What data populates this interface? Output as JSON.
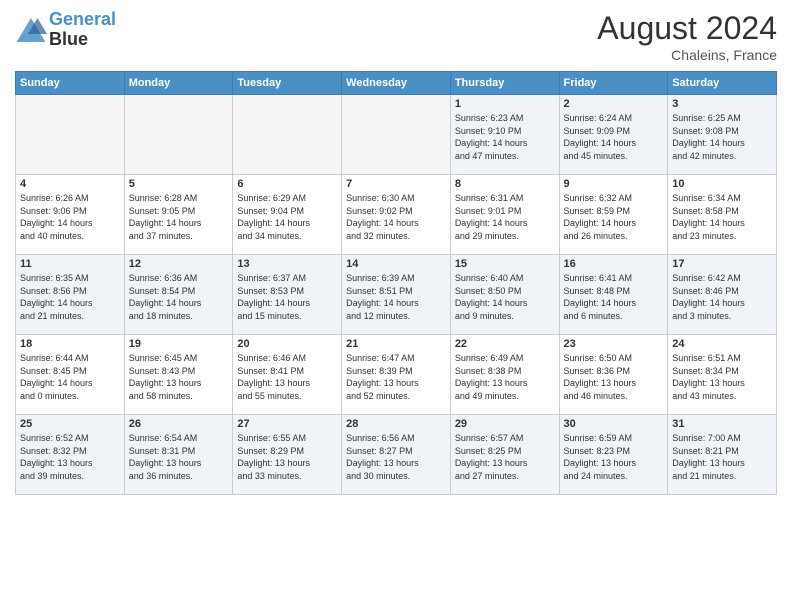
{
  "header": {
    "logo_line1": "General",
    "logo_line2": "Blue",
    "month_year": "August 2024",
    "location": "Chaleins, France"
  },
  "weekdays": [
    "Sunday",
    "Monday",
    "Tuesday",
    "Wednesday",
    "Thursday",
    "Friday",
    "Saturday"
  ],
  "weeks": [
    [
      {
        "day": "",
        "info": ""
      },
      {
        "day": "",
        "info": ""
      },
      {
        "day": "",
        "info": ""
      },
      {
        "day": "",
        "info": ""
      },
      {
        "day": "1",
        "info": "Sunrise: 6:23 AM\nSunset: 9:10 PM\nDaylight: 14 hours\nand 47 minutes."
      },
      {
        "day": "2",
        "info": "Sunrise: 6:24 AM\nSunset: 9:09 PM\nDaylight: 14 hours\nand 45 minutes."
      },
      {
        "day": "3",
        "info": "Sunrise: 6:25 AM\nSunset: 9:08 PM\nDaylight: 14 hours\nand 42 minutes."
      }
    ],
    [
      {
        "day": "4",
        "info": "Sunrise: 6:26 AM\nSunset: 9:06 PM\nDaylight: 14 hours\nand 40 minutes."
      },
      {
        "day": "5",
        "info": "Sunrise: 6:28 AM\nSunset: 9:05 PM\nDaylight: 14 hours\nand 37 minutes."
      },
      {
        "day": "6",
        "info": "Sunrise: 6:29 AM\nSunset: 9:04 PM\nDaylight: 14 hours\nand 34 minutes."
      },
      {
        "day": "7",
        "info": "Sunrise: 6:30 AM\nSunset: 9:02 PM\nDaylight: 14 hours\nand 32 minutes."
      },
      {
        "day": "8",
        "info": "Sunrise: 6:31 AM\nSunset: 9:01 PM\nDaylight: 14 hours\nand 29 minutes."
      },
      {
        "day": "9",
        "info": "Sunrise: 6:32 AM\nSunset: 8:59 PM\nDaylight: 14 hours\nand 26 minutes."
      },
      {
        "day": "10",
        "info": "Sunrise: 6:34 AM\nSunset: 8:58 PM\nDaylight: 14 hours\nand 23 minutes."
      }
    ],
    [
      {
        "day": "11",
        "info": "Sunrise: 6:35 AM\nSunset: 8:56 PM\nDaylight: 14 hours\nand 21 minutes."
      },
      {
        "day": "12",
        "info": "Sunrise: 6:36 AM\nSunset: 8:54 PM\nDaylight: 14 hours\nand 18 minutes."
      },
      {
        "day": "13",
        "info": "Sunrise: 6:37 AM\nSunset: 8:53 PM\nDaylight: 14 hours\nand 15 minutes."
      },
      {
        "day": "14",
        "info": "Sunrise: 6:39 AM\nSunset: 8:51 PM\nDaylight: 14 hours\nand 12 minutes."
      },
      {
        "day": "15",
        "info": "Sunrise: 6:40 AM\nSunset: 8:50 PM\nDaylight: 14 hours\nand 9 minutes."
      },
      {
        "day": "16",
        "info": "Sunrise: 6:41 AM\nSunset: 8:48 PM\nDaylight: 14 hours\nand 6 minutes."
      },
      {
        "day": "17",
        "info": "Sunrise: 6:42 AM\nSunset: 8:46 PM\nDaylight: 14 hours\nand 3 minutes."
      }
    ],
    [
      {
        "day": "18",
        "info": "Sunrise: 6:44 AM\nSunset: 8:45 PM\nDaylight: 14 hours\nand 0 minutes."
      },
      {
        "day": "19",
        "info": "Sunrise: 6:45 AM\nSunset: 8:43 PM\nDaylight: 13 hours\nand 58 minutes."
      },
      {
        "day": "20",
        "info": "Sunrise: 6:46 AM\nSunset: 8:41 PM\nDaylight: 13 hours\nand 55 minutes."
      },
      {
        "day": "21",
        "info": "Sunrise: 6:47 AM\nSunset: 8:39 PM\nDaylight: 13 hours\nand 52 minutes."
      },
      {
        "day": "22",
        "info": "Sunrise: 6:49 AM\nSunset: 8:38 PM\nDaylight: 13 hours\nand 49 minutes."
      },
      {
        "day": "23",
        "info": "Sunrise: 6:50 AM\nSunset: 8:36 PM\nDaylight: 13 hours\nand 46 minutes."
      },
      {
        "day": "24",
        "info": "Sunrise: 6:51 AM\nSunset: 8:34 PM\nDaylight: 13 hours\nand 43 minutes."
      }
    ],
    [
      {
        "day": "25",
        "info": "Sunrise: 6:52 AM\nSunset: 8:32 PM\nDaylight: 13 hours\nand 39 minutes."
      },
      {
        "day": "26",
        "info": "Sunrise: 6:54 AM\nSunset: 8:31 PM\nDaylight: 13 hours\nand 36 minutes."
      },
      {
        "day": "27",
        "info": "Sunrise: 6:55 AM\nSunset: 8:29 PM\nDaylight: 13 hours\nand 33 minutes."
      },
      {
        "day": "28",
        "info": "Sunrise: 6:56 AM\nSunset: 8:27 PM\nDaylight: 13 hours\nand 30 minutes."
      },
      {
        "day": "29",
        "info": "Sunrise: 6:57 AM\nSunset: 8:25 PM\nDaylight: 13 hours\nand 27 minutes."
      },
      {
        "day": "30",
        "info": "Sunrise: 6:59 AM\nSunset: 8:23 PM\nDaylight: 13 hours\nand 24 minutes."
      },
      {
        "day": "31",
        "info": "Sunrise: 7:00 AM\nSunset: 8:21 PM\nDaylight: 13 hours\nand 21 minutes."
      }
    ]
  ]
}
